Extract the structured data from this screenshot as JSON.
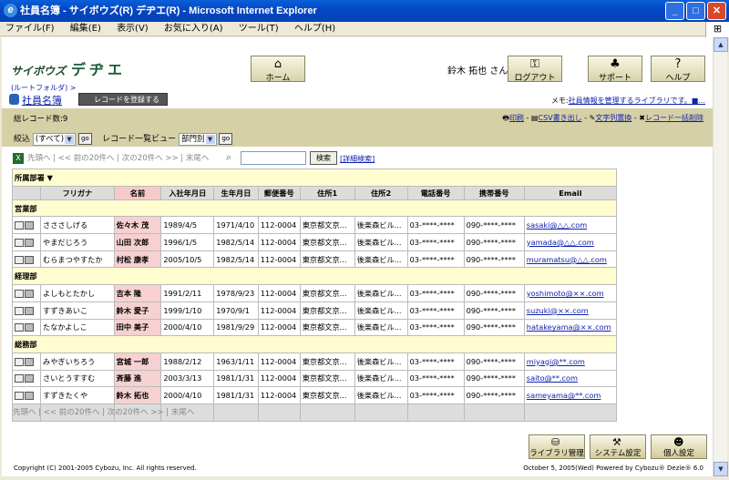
{
  "window": {
    "title": "社員名簿 - サイボウズ(R) デヂエ(R) - Microsoft Internet Explorer"
  },
  "menu": [
    "ファイル(F)",
    "編集(E)",
    "表示(V)",
    "お気に入り(A)",
    "ツール(T)",
    "ヘルプ(H)"
  ],
  "header": {
    "logo": "サイボウズ",
    "logo_sub": "デヂエ",
    "home": "ホーム",
    "user": "鈴木 拓也 さん",
    "logout": "ログアウト",
    "support": "サポート",
    "help": "ヘルプ"
  },
  "breadcrumb": "(ルートフォルダ) >",
  "app_title": "社員名簿",
  "register_button": "レコードを登録する",
  "memo_label": "メモ:",
  "memo_link": "社員情報を管理するライブラリです。■...",
  "total": "総レコード数:9",
  "tools": {
    "print": "印刷",
    "csv": "CSV書き出し",
    "replace": "文字列置換",
    "delete_all": "レコード一括削除"
  },
  "filter": {
    "label": "絞込",
    "value": "(すべて)",
    "go": "go",
    "view_label": "レコード一覧ビュー",
    "view_value": "部門別"
  },
  "pager": "先頭へ | << 前の20件へ | 次の20件へ >> | 末尾へ",
  "search": {
    "button": "検索",
    "advanced": "[詳細検索]"
  },
  "table": {
    "group_header": "所属部署",
    "columns": [
      "フリガナ",
      "名前",
      "入社年月日",
      "生年月日",
      "郵便番号",
      "住所1",
      "住所2",
      "電話番号",
      "携帯番号",
      "Email"
    ],
    "groups": [
      {
        "name": "営業部",
        "rows": [
          [
            "さささしげる",
            "佐々木 茂",
            "1989/4/5",
            "1971/4/10",
            "112-0004",
            "東京都文京...",
            "後楽森ビル...",
            "03-****-****",
            "090-****-****",
            "sasaki@△△.com"
          ],
          [
            "やまだじろう",
            "山田 次郎",
            "1996/1/5",
            "1982/5/14",
            "112-0004",
            "東京都文京...",
            "後楽森ビル...",
            "03-****-****",
            "090-****-****",
            "yamada@△△.com"
          ],
          [
            "むらまつやすたか",
            "村松 康孝",
            "2005/10/5",
            "1982/5/14",
            "112-0004",
            "東京都文京...",
            "後楽森ビル...",
            "03-****-****",
            "090-****-****",
            "muramatsu@△△.com"
          ]
        ]
      },
      {
        "name": "経理部",
        "rows": [
          [
            "よしもとたかし",
            "吉本 隆",
            "1991/2/11",
            "1978/9/23",
            "112-0004",
            "東京都文京...",
            "後楽森ビル...",
            "03-****-****",
            "090-****-****",
            "yoshimoto@××.com"
          ],
          [
            "すずきあいこ",
            "鈴木 愛子",
            "1999/1/10",
            "1970/9/1",
            "112-0004",
            "東京都文京...",
            "後楽森ビル...",
            "03-****-****",
            "090-****-****",
            "suzuki@××.com"
          ],
          [
            "たなかよしこ",
            "田中 美子",
            "2000/4/10",
            "1981/9/29",
            "112-0004",
            "東京都文京...",
            "後楽森ビル...",
            "03-****-****",
            "090-****-****",
            "hatakeyama@××.com"
          ]
        ]
      },
      {
        "name": "総務部",
        "rows": [
          [
            "みやぎいちろう",
            "宮城 一郎",
            "1988/2/12",
            "1963/1/11",
            "112-0004",
            "東京都文京...",
            "後楽森ビル...",
            "03-****-****",
            "090-****-****",
            "miyagi@**.com"
          ],
          [
            "さいとうすすむ",
            "斉藤 進",
            "2003/3/13",
            "1981/1/31",
            "112-0004",
            "東京都文京...",
            "後楽森ビル...",
            "03-****-****",
            "090-****-****",
            "saito@**.com"
          ],
          [
            "すずきたくや",
            "鈴木 拓也",
            "2000/4/10",
            "1981/1/31",
            "112-0004",
            "東京都文京...",
            "後楽森ビル...",
            "03-****-****",
            "090-****-****",
            "sameyama@**.com"
          ]
        ]
      }
    ]
  },
  "footer": {
    "library_admin": "ライブラリ管理",
    "system_settings": "システム設定",
    "personal_settings": "個人設定",
    "copyright": "Copyright (C) 2001-2005 Cybozu, Inc. All rights reserved.",
    "date": "October 5, 2005(Wed)   Powered by Cybozu® Dezie® 6.0"
  }
}
